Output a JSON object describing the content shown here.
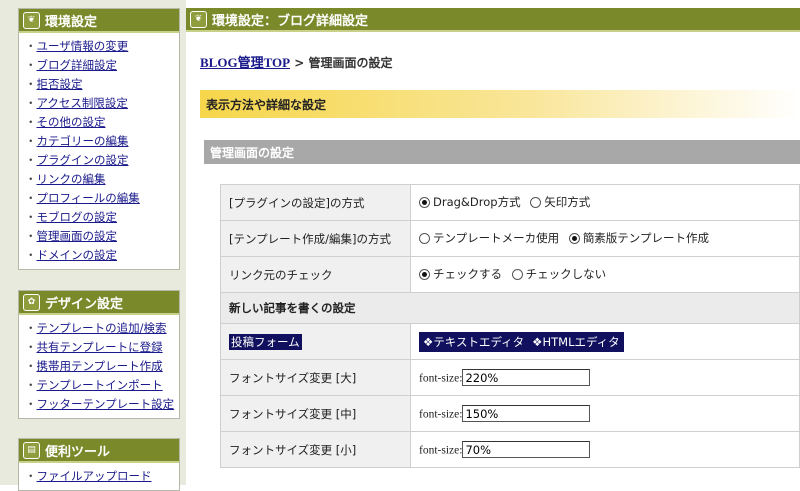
{
  "sidebar": {
    "env": {
      "title": "環境設定",
      "icon": "leaf-icon",
      "items": [
        "ユーザ情報の変更",
        "ブログ詳細設定",
        "拒否設定",
        "アクセス制限設定",
        "その他の設定",
        "カテゴリーの編集",
        "プラグインの設定",
        "リンクの編集",
        "プロフィールの編集",
        "モブログの設定",
        "管理画面の設定",
        "ドメインの設定"
      ]
    },
    "design": {
      "title": "デザイン設定",
      "icon": "palette-icon",
      "items": [
        "テンプレートの追加/検索",
        "共有テンプレートに登録",
        "携帯用テンプレート作成",
        "テンプレートインポート",
        "フッターテンプレート設定"
      ]
    },
    "tools": {
      "title": "便利ツール",
      "icon": "toolbox-icon",
      "items": [
        "ファイルアップロード"
      ]
    }
  },
  "main": {
    "header": "環境設定：ブログ詳細設定",
    "breadcrumb": {
      "link": "BLOG管理TOP",
      "sep": " > ",
      "current": "管理画面の設定"
    },
    "section_title": "表示方法や詳細な設定",
    "subsection_title": "管理画面の設定",
    "rows": [
      {
        "label": "[プラグインの設定]の方式",
        "options": [
          "Drag&Drop方式",
          "矢印方式"
        ],
        "selected": 0
      },
      {
        "label": "[テンプレート作成/編集]の方式",
        "options": [
          "テンプレートメーカ使用",
          "簡素版テンプレート作成"
        ],
        "selected": 1
      },
      {
        "label": "リンク元のチェック",
        "options": [
          "チェックする",
          "チェックしない"
        ],
        "selected": 0
      }
    ],
    "new_post_heading": "新しい記事を書くの設定",
    "post_form": {
      "label": "投稿フォーム",
      "options": [
        "テキストエディタ",
        "HTMLエディタ"
      ]
    },
    "font_sizes": [
      {
        "label": "フォントサイズ変更 [大]",
        "prefix": "font-size:",
        "value": "220%"
      },
      {
        "label": "フォントサイズ変更 [中]",
        "prefix": "font-size:",
        "value": "150%"
      },
      {
        "label": "フォントサイズ変更 [小]",
        "prefix": "font-size:",
        "value": "70%"
      }
    ]
  },
  "colors": {
    "header_green": "#7a8a2a",
    "sidebar_bg": "#e8eadd",
    "highlight_navy": "#10105e",
    "section_yellow": "#f6d64a",
    "subsection_gray": "#a8a8a8"
  }
}
